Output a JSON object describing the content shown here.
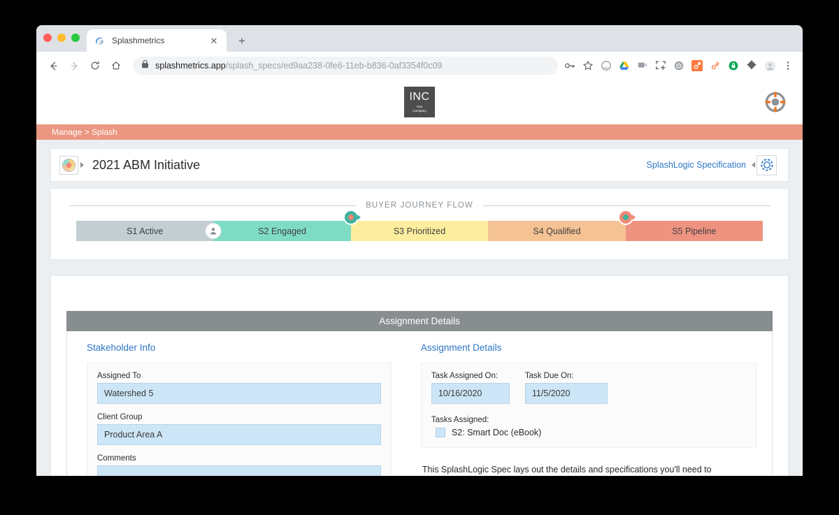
{
  "browser": {
    "tab": {
      "title": "Splashmetrics",
      "favicon": "splashmetrics-favicon",
      "close_label": "✕"
    },
    "new_tab_label": "+",
    "nav": {
      "back": "←",
      "forward": "→",
      "reload": "↻",
      "home": "⌂"
    },
    "omnibox": {
      "secure_icon": "lock-icon",
      "url_domain": "splashmetrics.app",
      "url_path": "/splash_specs/ed9aa238-0fe6-11eb-b836-0af3354f0c09",
      "full_url": "splashmetrics.app/splash_specs/ed9aa238-0fe6-11eb-b836-0af3354f0c09"
    },
    "extensions": [
      {
        "name": "password-key-icon"
      },
      {
        "name": "bookmark-star-icon"
      },
      {
        "name": "circle-gray-icon"
      },
      {
        "name": "google-drive-icon"
      },
      {
        "name": "video-chat-icon"
      },
      {
        "name": "screenshot-capture-icon"
      },
      {
        "name": "shield-power-icon"
      },
      {
        "name": "hubspot-sprocket-orange-icon"
      },
      {
        "name": "hubspot-sprocket-outline-icon"
      },
      {
        "name": "green-lock-icon"
      },
      {
        "name": "puzzle-extension-icon"
      },
      {
        "name": "profile-avatar-icon"
      },
      {
        "name": "chrome-menu-icon"
      }
    ]
  },
  "brandbar": {
    "logo_main": "INC",
    "logo_sub_line1": "Your",
    "logo_sub_line2": "Company",
    "help_icon": "lifesaver-support-icon"
  },
  "breadcrumb": {
    "text": "Manage > Splash"
  },
  "title_card": {
    "initiative_icon": "initiative-segments-icon",
    "title": "2021 ABM Initiative",
    "spec_link": "SplashLogic Specification",
    "spec_icon": "splashlogic-gear-icon"
  },
  "journey": {
    "label": "BUYER JOURNEY FLOW",
    "stages": [
      {
        "label": "S1 Active",
        "color": "#c2ced2"
      },
      {
        "label": "S2 Engaged",
        "color": "#7fdcc4"
      },
      {
        "label": "S3 Prioritized",
        "color": "#fcee9e"
      },
      {
        "label": "S4 Qualified",
        "color": "#f5c293"
      },
      {
        "label": "S5 Pipeline",
        "color": "#ef9381"
      }
    ],
    "persona_marker": {
      "icon": "persona-avatar-icon",
      "after_stage": 1
    },
    "markers": [
      {
        "name": "stage-marker-s2-s3",
        "after_stage": 2,
        "ring": "#3db39e",
        "center": "#ee8878"
      },
      {
        "name": "stage-marker-s4-s5",
        "after_stage": 4,
        "ring": "#ef8977",
        "center": "#3db39e"
      }
    ]
  },
  "assignment": {
    "panel_title": "Assignment Details",
    "stakeholder": {
      "heading": "Stakeholder Info",
      "fields": [
        {
          "label": "Assigned To",
          "value": "Watershed 5"
        },
        {
          "label": "Client Group",
          "value": "Product Area A"
        },
        {
          "label": "Comments",
          "value": ""
        }
      ]
    },
    "details": {
      "heading": "Assignment Details",
      "assigned_on_label": "Task Assigned On:",
      "assigned_on_value": "10/16/2020",
      "due_on_label": "Task Due On:",
      "due_on_value": "11/5/2020",
      "tasks_label": "Tasks Assigned:",
      "tasks": [
        {
          "label": "S2: Smart Doc (eBook)",
          "checked": true
        }
      ]
    },
    "spec_paragraph": "This SplashLogic Spec lays out the details and specifications you'll need to"
  },
  "colors": {
    "breadcrumb_bg": "#eb9680",
    "link_blue": "#2f76c4",
    "panel_header_gray": "#888d8f",
    "field_blue": "#cde6f7"
  }
}
